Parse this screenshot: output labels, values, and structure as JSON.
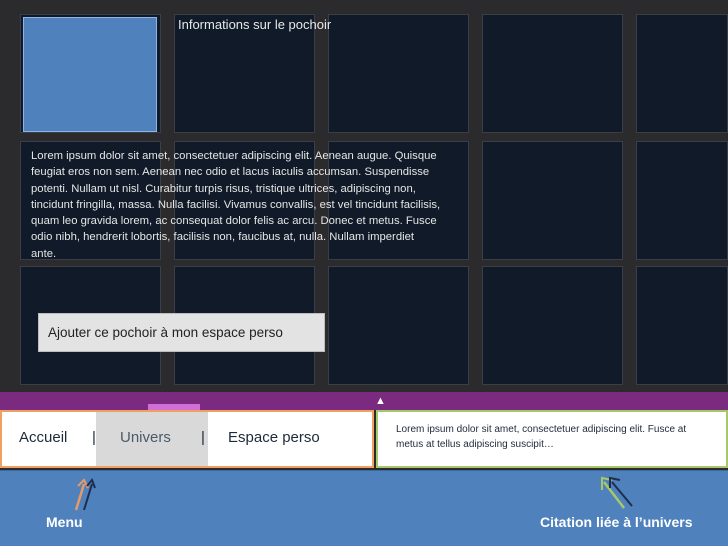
{
  "info_panel": {
    "title": "Informations sur le pochoir",
    "description": "Lorem ipsum dolor sit amet, consectetuer adipiscing elit. Aenean augue. Quisque feugiat eros non sem. Aenean nec odio et lacus iaculis accumsan. Suspendisse potenti. Nullam ut nisl. Curabitur turpis risus, tristique ultrices, adipiscing non, tincidunt fringilla, massa. Nulla facilisi. Vivamus convallis, est vel tincidunt facilisis, quam leo gravida lorem, ac consequat dolor felis ac arcu. Donec et metus. Fusce odio nibh, hendrerit lobortis, facilisis non, faucibus at, nulla. Nullam imperdiet ante.",
    "add_button_label": "Ajouter ce pochoir à mon espace perso"
  },
  "nav": {
    "items": [
      {
        "label": "Accueil"
      },
      {
        "label": "Univers"
      },
      {
        "label": "Espace perso"
      }
    ],
    "separator": "|",
    "active_index": 1
  },
  "quote": {
    "text": "Lorem ipsum dolor sit amet, consectetuer adipiscing elit. Fusce at metus at tellus adipiscing suscipit…"
  },
  "annotations": {
    "menu_label": "Menu",
    "citation_label": "Citation liée à l’univers"
  },
  "toggle_icon": "▲",
  "colors": {
    "tile_bg": "#101a28",
    "selected_tile": "#4f81bd",
    "purple_bar": "#7a2a7f",
    "purple_accent": "#d070d6",
    "nav_border": "#f0a060",
    "quote_border": "#a6c86a",
    "annotation_area": "#4f81bd"
  }
}
